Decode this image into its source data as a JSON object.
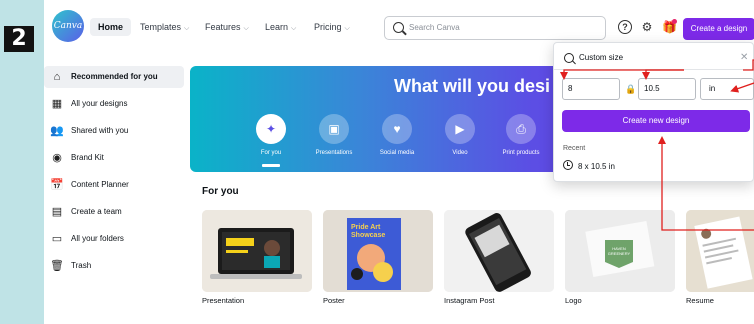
{
  "step_badge": "2",
  "topbar": {
    "logo_text": "Canva",
    "nav": [
      {
        "label": "Home",
        "has_chevron": false
      },
      {
        "label": "Templates",
        "has_chevron": true
      },
      {
        "label": "Features",
        "has_chevron": true
      },
      {
        "label": "Learn",
        "has_chevron": true
      },
      {
        "label": "Pricing",
        "has_chevron": true
      }
    ],
    "search_placeholder": "Search Canva",
    "help_glyph": "?",
    "settings_glyph": "⚙",
    "gift_glyph": "🎁",
    "create_button": "Create a design"
  },
  "sidebar": {
    "items": [
      {
        "label": "Recommended for you",
        "icon": "home-icon",
        "glyph": "⌂",
        "active": true
      },
      {
        "label": "All your designs",
        "icon": "grid-icon",
        "glyph": "▦",
        "active": false
      },
      {
        "label": "Shared with you",
        "icon": "people-icon",
        "glyph": "👥",
        "active": false
      },
      {
        "label": "Brand Kit",
        "icon": "brand-icon",
        "glyph": "◉",
        "active": false
      },
      {
        "label": "Content Planner",
        "icon": "calendar-icon",
        "glyph": "📅",
        "active": false
      },
      {
        "label": "Create a team",
        "icon": "team-icon",
        "glyph": "▤",
        "active": false
      },
      {
        "label": "All your folders",
        "icon": "folder-icon",
        "glyph": "▭",
        "active": false
      },
      {
        "label": "Trash",
        "icon": "trash-icon",
        "glyph": "🗑",
        "active": false
      }
    ]
  },
  "hero": {
    "title": "What will you desi",
    "categories": [
      {
        "label": "For you",
        "icon": "sparkle-icon",
        "glyph": "✦",
        "active": true
      },
      {
        "label": "Presentations",
        "icon": "presentation-icon",
        "glyph": "▣",
        "active": false
      },
      {
        "label": "Social media",
        "icon": "heart-icon",
        "glyph": "♥",
        "active": false
      },
      {
        "label": "Video",
        "icon": "video-icon",
        "glyph": "▶",
        "active": false
      },
      {
        "label": "Print products",
        "icon": "printer-icon",
        "glyph": "⎙",
        "active": false
      }
    ]
  },
  "for_you": {
    "heading": "For you",
    "cards": [
      {
        "label": "Presentation"
      },
      {
        "label": "Poster",
        "thumb_text": "Pride Art Showcase"
      },
      {
        "label": "Instagram Post"
      },
      {
        "label": "Logo",
        "thumb_text": "HAVEN GREENERY"
      },
      {
        "label": "Resume"
      }
    ]
  },
  "custom_size": {
    "query": "Custom size",
    "close_glyph": "✕",
    "width": "8",
    "height": "10.5",
    "lock_glyph": "🔒",
    "unit": "in",
    "create_button": "Create new design",
    "recent_label": "Recent",
    "recent_items": [
      "8 x 10.5 in"
    ]
  },
  "colors": {
    "brand_purple": "#7d2ae8",
    "annotation_red": "#e0201e",
    "background": "#bfe3e6"
  }
}
